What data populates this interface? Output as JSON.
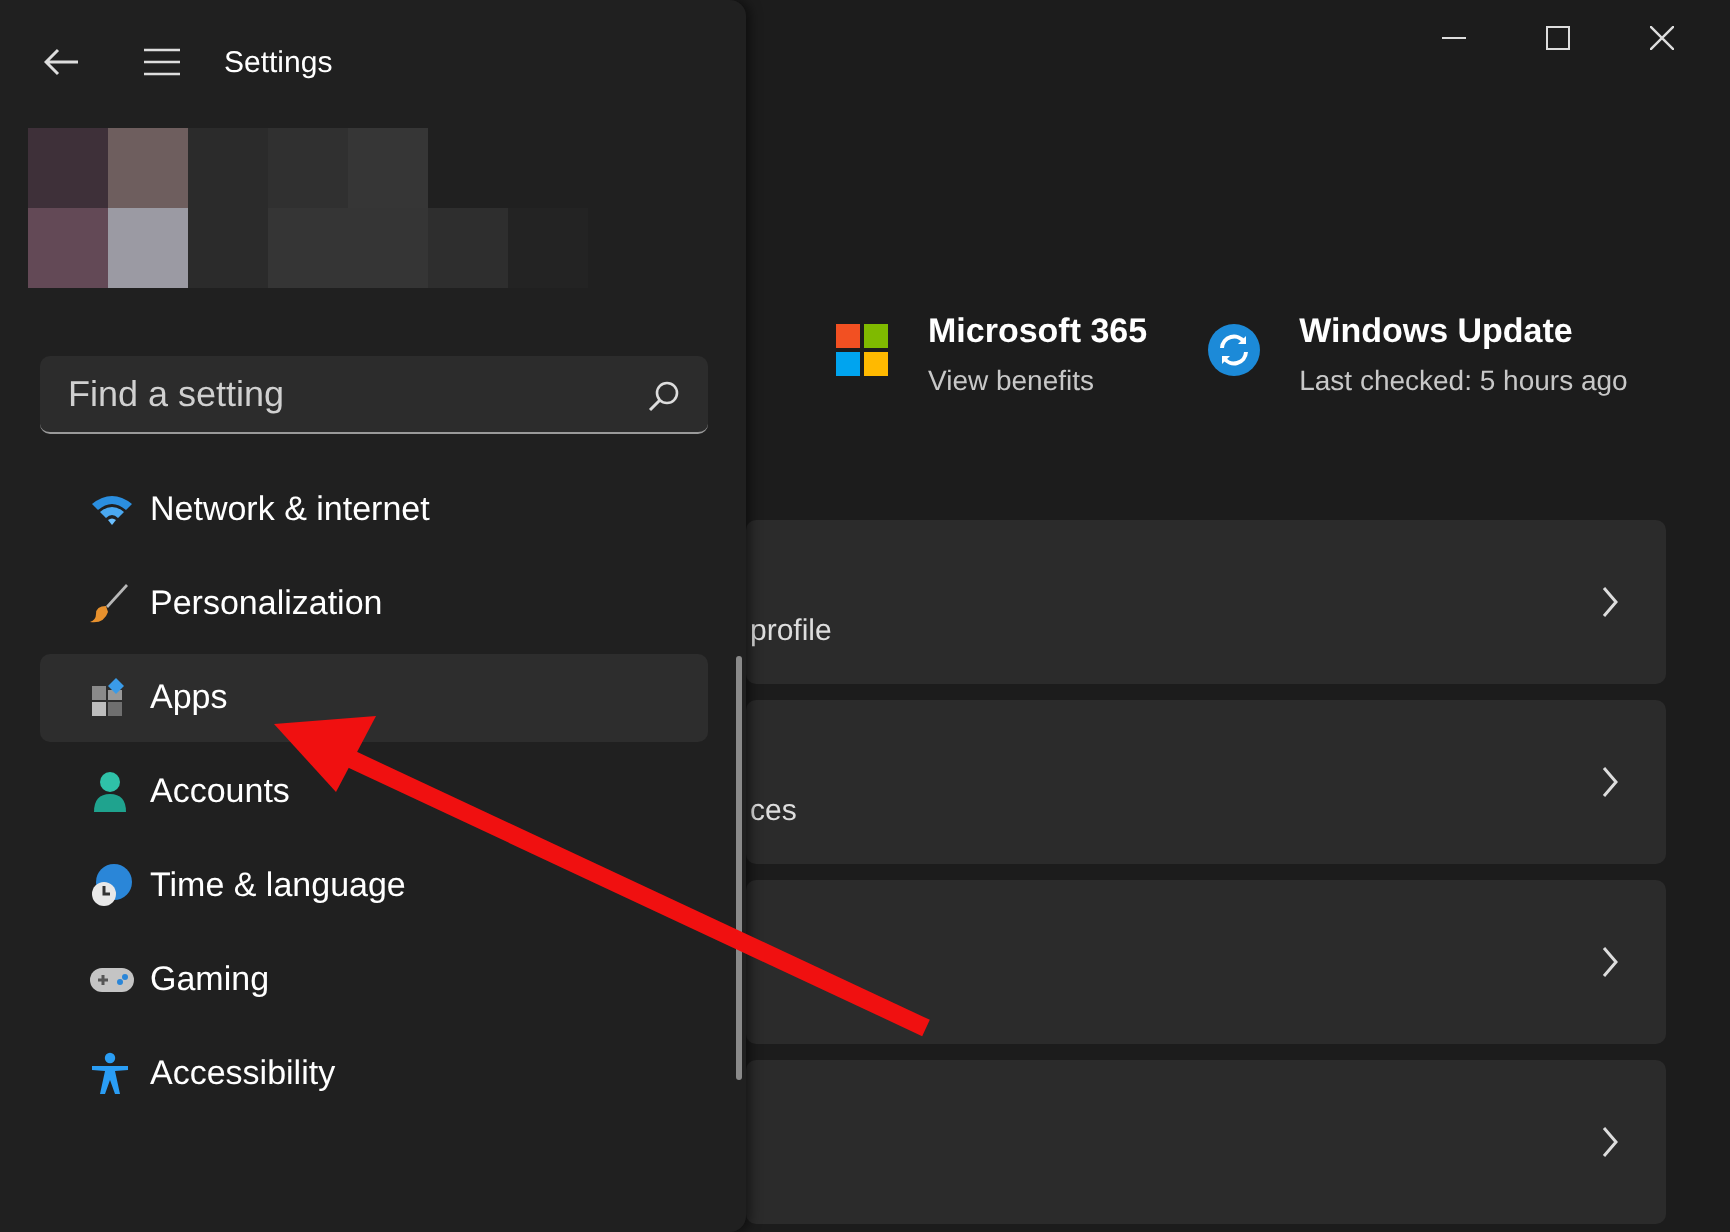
{
  "window": {
    "title": "Settings"
  },
  "sidebar": {
    "search": {
      "placeholder": "Find a setting"
    },
    "items": [
      {
        "label": "Network & internet",
        "selected": false
      },
      {
        "label": "Personalization",
        "selected": false
      },
      {
        "label": "Apps",
        "selected": true
      },
      {
        "label": "Accounts",
        "selected": false
      },
      {
        "label": "Time & language",
        "selected": false
      },
      {
        "label": "Gaming",
        "selected": false
      },
      {
        "label": "Accessibility",
        "selected": false
      }
    ]
  },
  "tiles": [
    {
      "title": "Microsoft 365",
      "subtitle": "View benefits"
    },
    {
      "title": "Windows Update",
      "subtitle": "Last checked: 5 hours ago"
    }
  ],
  "cards": [
    {
      "subtitle": "profile",
      "chevron": true
    },
    {
      "subtitle": "ces",
      "chevron": true
    },
    {
      "chevron": true
    },
    {
      "chevron": true
    }
  ]
}
